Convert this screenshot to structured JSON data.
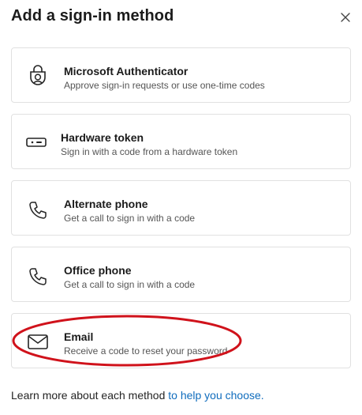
{
  "dialog": {
    "title": "Add a sign-in method",
    "close_icon": "close-icon"
  },
  "methods": [
    {
      "title": "Microsoft Authenticator",
      "description": "Approve sign-in requests or use one-time codes",
      "icon": "authenticator-lock-icon"
    },
    {
      "title": "Hardware token",
      "description": "Sign in with a code from a hardware token",
      "icon": "hardware-token-icon"
    },
    {
      "title": "Alternate phone",
      "description": "Get a call to sign in with a code",
      "icon": "phone-icon"
    },
    {
      "title": "Office phone",
      "description": "Get a call to sign in with a code",
      "icon": "phone-icon"
    },
    {
      "title": "Email",
      "description": "Receive a code to reset your password",
      "icon": "mail-icon"
    }
  ],
  "footer": {
    "text": "Learn more about each method ",
    "link": "to help you choose."
  },
  "colors": {
    "link": "#0f6cbd",
    "highlight_ellipse": "#d0121b",
    "card_border": "#e1e1e1"
  }
}
